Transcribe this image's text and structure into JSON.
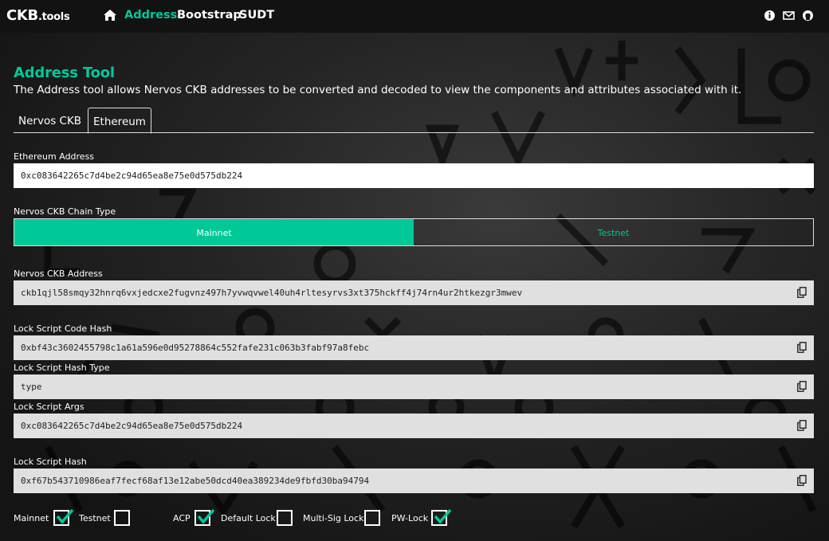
{
  "nav": {
    "brand_main": "CKB",
    "brand_suffix": ".tools",
    "links": [
      "Address",
      "Bootstrap",
      "SUDT"
    ]
  },
  "page": {
    "title": "Address Tool",
    "description": "The Address tool allows Nervos CKB addresses to be converted and decoded to view the components and attributes associated with it."
  },
  "tabs": [
    "Nervos CKB",
    "Ethereum"
  ],
  "fields": {
    "eth_address_label": "Ethereum Address",
    "eth_address_value": "0xc083642265c7d4be2c94d65ea8e75e0d575db224",
    "chain_type_label": "Nervos CKB Chain Type",
    "chain_mainnet": "Mainnet",
    "chain_testnet": "Testnet",
    "ckb_address_label": "Nervos CKB Address",
    "ckb_address_value": "ckb1qjl58smqy32hnrq6vxjedcxe2fugvnz497h7yvwqvwel40uh4rltesyrvs3xt375hckff4j74rn4ur2htkezgr3mwev",
    "code_hash_label": "Lock Script Code Hash",
    "code_hash_value": "0xbf43c3602455798c1a61a596e0d95278864c552fafe231c063b3fabf97a8febc",
    "hash_type_label": "Lock Script Hash Type",
    "hash_type_value": "type",
    "args_label": "Lock Script Args",
    "args_value": "0xc083642265c7d4be2c94d65ea8e75e0d575db224",
    "script_hash_label": "Lock Script Hash",
    "script_hash_value": "0xf67b543710986eaf7fecf68af13e12abe50dcd40ea389234de9fbfd30ba94794"
  },
  "checkboxes": [
    {
      "label": "Mainnet",
      "checked": true
    },
    {
      "label": "Testnet",
      "checked": false
    },
    {
      "label": "ACP",
      "checked": true
    },
    {
      "label": "Default Lock",
      "checked": false
    },
    {
      "label": "Multi-Sig Lock",
      "checked": false
    },
    {
      "label": "PW-Lock",
      "checked": true
    }
  ],
  "colors": {
    "accent": "#00c897",
    "nav_bg": "#121212"
  },
  "icons": [
    "home-icon",
    "info-icon",
    "envelope-icon",
    "github-icon",
    "copy-icon",
    "checkmark-icon"
  ]
}
